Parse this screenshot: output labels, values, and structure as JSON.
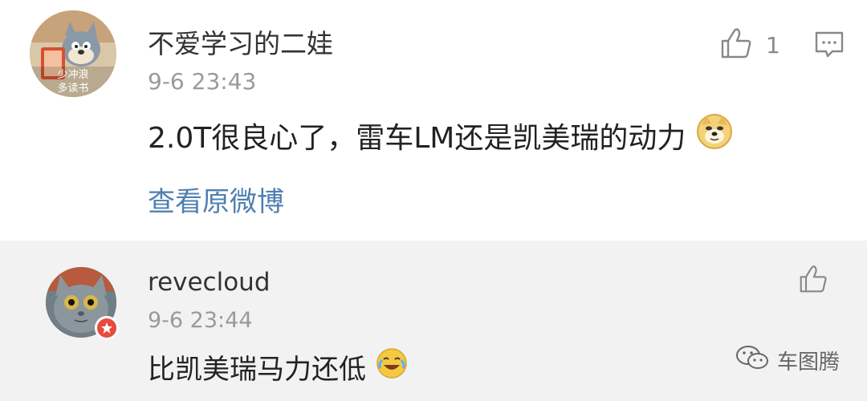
{
  "comments": [
    {
      "username": "不爱学习的二娃",
      "time": "9-6 23:43",
      "content": "2.0T很良心了，雷车LM还是凯美瑞的动力",
      "emoji": "doge",
      "likes": "1",
      "link": "查看原微博",
      "avatar_text": [
        "少冲浪",
        "多读书"
      ]
    },
    {
      "username": "revecloud",
      "time": "9-6 23:44",
      "content": "比凯美瑞马力还低",
      "emoji": "laugh-cry"
    }
  ],
  "watermark": "车图腾"
}
